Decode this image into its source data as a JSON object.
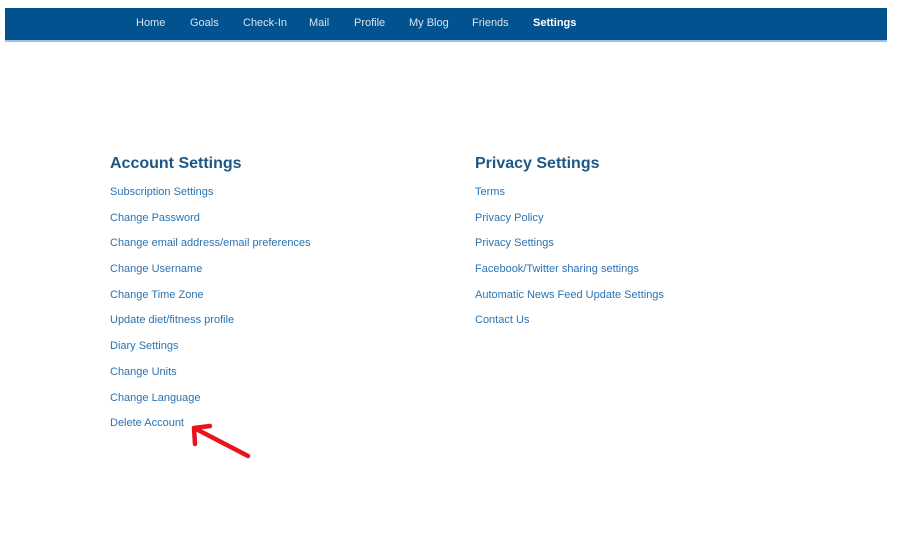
{
  "nav": {
    "items": [
      {
        "label": "Home",
        "active": false
      },
      {
        "label": "Goals",
        "active": false
      },
      {
        "label": "Check-In",
        "active": false
      },
      {
        "label": "Mail",
        "active": false
      },
      {
        "label": "Profile",
        "active": false
      },
      {
        "label": "My Blog",
        "active": false
      },
      {
        "label": "Friends",
        "active": false
      },
      {
        "label": "Settings",
        "active": true
      }
    ]
  },
  "account_settings": {
    "title": "Account Settings",
    "links": [
      "Subscription Settings",
      "Change Password",
      "Change email address/email preferences",
      "Change Username",
      "Change Time Zone",
      "Update diet/fitness profile",
      "Diary Settings",
      "Change Units",
      "Change Language",
      "Delete Account"
    ]
  },
  "privacy_settings": {
    "title": "Privacy Settings",
    "links": [
      "Terms",
      "Privacy Policy",
      "Privacy Settings",
      "Facebook/Twitter sharing settings",
      "Automatic News Feed Update Settings",
      "Contact Us"
    ]
  },
  "annotation": {
    "icon": "red-arrow-icon",
    "color": "#e8141b",
    "points_to": "Delete Account"
  },
  "colors": {
    "nav_bg": "#02528f",
    "heading": "#1c5786",
    "link": "#2a73b3"
  }
}
